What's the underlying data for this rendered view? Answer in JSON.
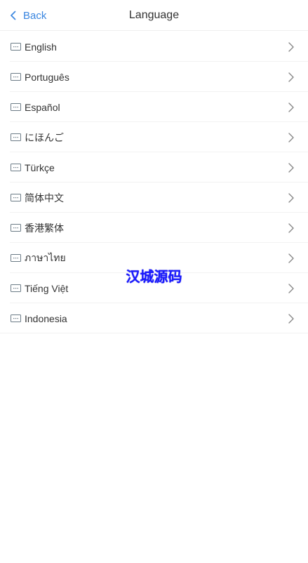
{
  "header": {
    "back_label": "Back",
    "title": "Language"
  },
  "languages": [
    {
      "label": "English"
    },
    {
      "label": "Português"
    },
    {
      "label": "Español"
    },
    {
      "label": "にほんご"
    },
    {
      "label": "Türkçe"
    },
    {
      "label": "简体中文"
    },
    {
      "label": "香港繁体"
    },
    {
      "label": "ภาษาไทย"
    },
    {
      "label": "Tiếng Việt"
    },
    {
      "label": "Indonesia"
    }
  ],
  "watermark": "汉城源码",
  "colors": {
    "accent": "#3a86e0",
    "watermark": "#1a1aff",
    "icon": "#6b7b86",
    "arrow": "#888888"
  },
  "icons": {
    "back": "chevron-left-icon",
    "language": "keyboard-icon",
    "row_arrow": "chevron-right-icon"
  }
}
